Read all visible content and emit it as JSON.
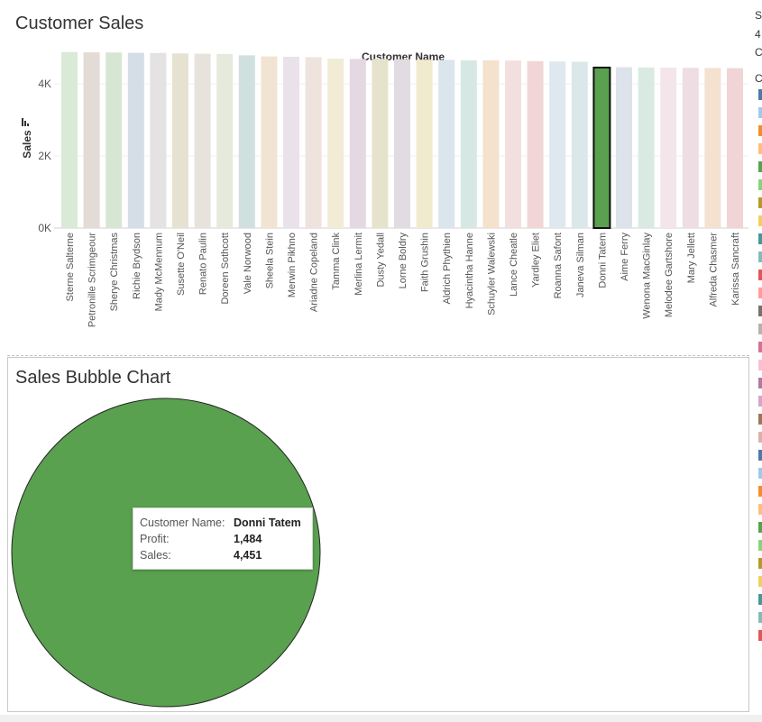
{
  "top_title": "Customer Sales",
  "bubble_title": "Sales Bubble Chart",
  "chart_data": [
    {
      "type": "bar",
      "title": "Customer Sales",
      "xlabel": "Customer Name",
      "ylabel": "Sales",
      "ylim": [
        0,
        5000
      ],
      "yticks": [
        {
          "value": 0,
          "label": "0K"
        },
        {
          "value": 2000,
          "label": "2K"
        },
        {
          "value": 4000,
          "label": "4K"
        }
      ],
      "grid": true,
      "highlighted": "Donni Tatem",
      "categories": [
        "Sterne Salterne",
        "Petronille Scrimgeour",
        "Sherye Christmas",
        "Richie Brydson",
        "Mady McMennum",
        "Susette O'Neil",
        "Renato Paulin",
        "Doreen Sothcott",
        "Vale Norwood",
        "Sheela Stein",
        "Merwin Pikhno",
        "Ariadne Copeland",
        "Tamma Clink",
        "Merlina Lermit",
        "Dusty Yedall",
        "Lorne Boldry",
        "Faith Grushin",
        "Aldrich Phythien",
        "Hyacintha Hanne",
        "Schuyler Walewski",
        "Lance Cheatle",
        "Yardley Eliet",
        "Roanna Safont",
        "Janeva Silman",
        "Donni Tatem",
        "Aime Ferry",
        "Wenona MacGinlay",
        "Melodee Gartshore",
        "Mary Jellett",
        "Alfreda Chasmer",
        "Karissa Sancraft"
      ],
      "values": [
        4880,
        4875,
        4870,
        4860,
        4855,
        4845,
        4835,
        4830,
        4790,
        4760,
        4750,
        4740,
        4700,
        4690,
        4690,
        4680,
        4670,
        4665,
        4655,
        4650,
        4645,
        4630,
        4620,
        4615,
        4451,
        4460,
        4455,
        4450,
        4445,
        4440,
        4435
      ],
      "colors": [
        "#d9ead7",
        "#e2dbd6",
        "#d6e6d2",
        "#d5dde6",
        "#e4e2e2",
        "#e6e2d2",
        "#e8e2dd",
        "#e6eadc",
        "#d0e0de",
        "#f2e4d2",
        "#eae2ea",
        "#efe3dd",
        "#f2ecd6",
        "#e4d8e2",
        "#e6e3cc",
        "#e1dbe2",
        "#f0eacf",
        "#dbe6ec",
        "#d6e8e4",
        "#f4e2cc",
        "#f4dfdf",
        "#f2d6d6",
        "#dfe8ee",
        "#dbe8ea",
        "#59a14f",
        "#dde3ea",
        "#d9eae3",
        "#f3e5ea",
        "#eedee4",
        "#f4e1d0",
        "#f0d4d6"
      ]
    },
    {
      "type": "scatter",
      "title": "Sales Bubble Chart",
      "points": [
        {
          "name": "Donni Tatem",
          "profit": 1484,
          "sales": 4451,
          "color": "#59a14f"
        }
      ]
    }
  ],
  "tooltip": {
    "rows": [
      {
        "label": "Customer Name:",
        "value": "Donni Tatem"
      },
      {
        "label": "Profit:",
        "value": "1,484"
      },
      {
        "label": "Sales:",
        "value": "4,451"
      }
    ]
  },
  "legend": {
    "letters": [
      {
        "text": "S",
        "top": 10
      },
      {
        "text": "4",
        "top": 31
      },
      {
        "text": "C",
        "top": 51
      },
      {
        "text": "C",
        "top": 80
      }
    ],
    "swatch_colors": [
      "#4e79a7",
      "#a0cbe8",
      "#f28e2b",
      "#ffbe7d",
      "#59a14f",
      "#8cd17d",
      "#b6992d",
      "#f1ce63",
      "#499894",
      "#86bcb6",
      "#e15759",
      "#ff9d9a",
      "#79706e",
      "#bab0ac",
      "#d37295",
      "#fabfd2",
      "#b07aa1",
      "#d4a6c8",
      "#9d7660",
      "#d7b5a6",
      "#4e79a7",
      "#a0cbe8",
      "#f28e2b",
      "#ffbe7d",
      "#59a14f",
      "#8cd17d",
      "#b6992d",
      "#f1ce63",
      "#499894",
      "#86bcb6",
      "#e15759"
    ]
  }
}
